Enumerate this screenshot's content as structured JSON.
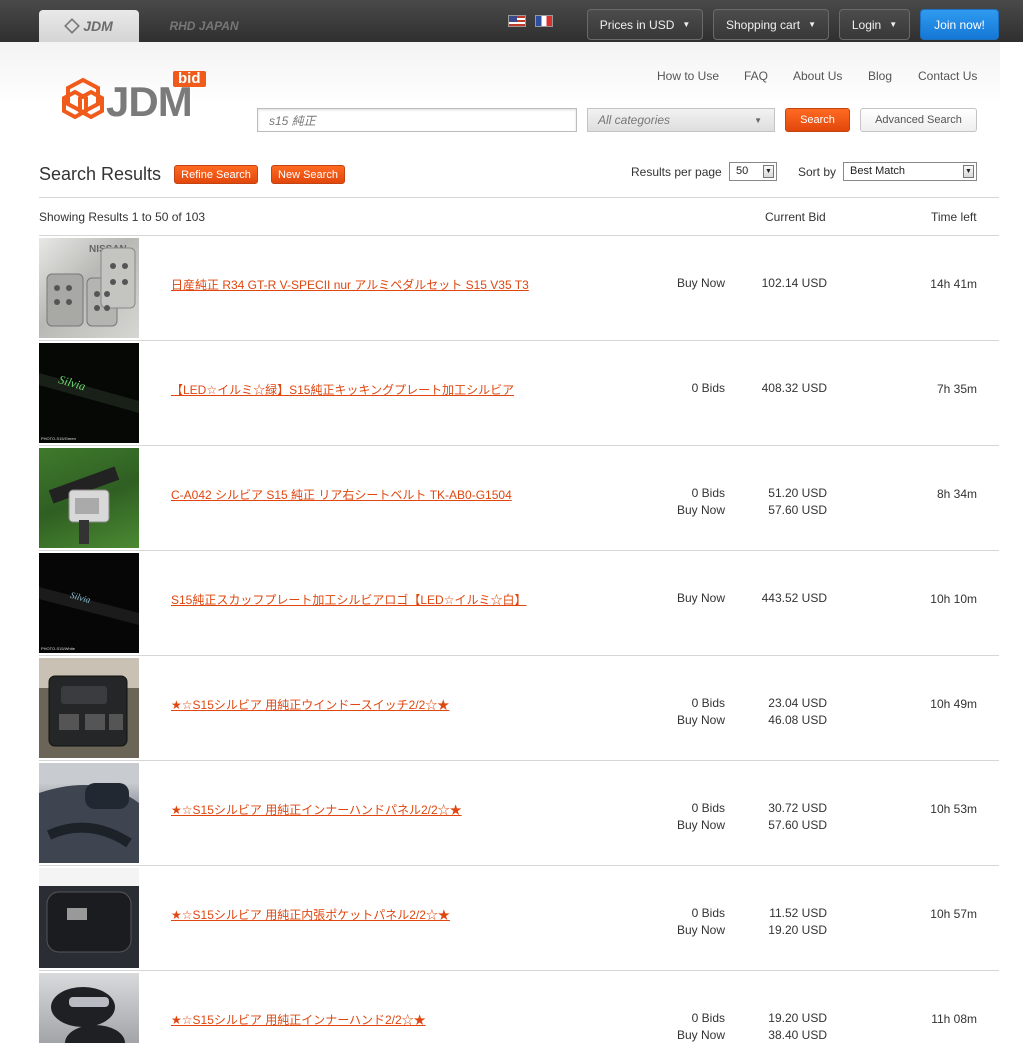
{
  "top_bar": {
    "site_tabs": [
      "JDM",
      "RHD JAPAN"
    ],
    "currency_label": "Prices in USD",
    "cart_label": "Shopping cart",
    "login_label": "Login",
    "join_label": "Join now!"
  },
  "logo": {
    "badge": "bid",
    "text": "JDM"
  },
  "nav": [
    "How to Use",
    "FAQ",
    "About Us",
    "Blog",
    "Contact Us"
  ],
  "search": {
    "query": "s15 純正",
    "category": "All categories",
    "search_label": "Search",
    "advanced_label": "Advanced Search"
  },
  "results": {
    "title": "Search Results",
    "refine_label": "Refine Search",
    "new_label": "New Search",
    "per_page_label": "Results per page",
    "per_page_value": "50",
    "sort_label": "Sort by",
    "sort_value": "Best Match",
    "showing": "Showing Results 1 to 50 of 103",
    "col_bid": "Current Bid",
    "col_time": "Time left"
  },
  "colors": {
    "accent": "#e2470b",
    "join": "#1a85e6",
    "topbar": "#3a3a3a"
  },
  "items": [
    {
      "title": "日産純正 R34 GT-R V-SPECII nur アルミペダルセット S15 V35 T3",
      "bids": "",
      "bid_price": "",
      "buy_label": "Buy Now",
      "buy_price": "102.14 USD",
      "time": "14h 41m",
      "thumb_caption": "",
      "thumb": "pedals"
    },
    {
      "title": "【LED☆イルミ☆緑】S15純正キッキングプレート加工シルビア",
      "bids": "0 Bids",
      "bid_price": "408.32 USD",
      "buy_label": "",
      "buy_price": "",
      "time": "7h 35m",
      "thumb_caption": "PHOTO-S15/Green",
      "thumb": "plate-green"
    },
    {
      "title": "C-A042 シルビア S15 純正 リア右シートベルト TK-AB0-G1504",
      "bids": "0 Bids",
      "bid_price": "51.20 USD",
      "buy_label": "Buy Now",
      "buy_price": "57.60 USD",
      "time": "8h 34m",
      "thumb_caption": "",
      "thumb": "belt"
    },
    {
      "title": "S15純正スカッフプレート加工シルビアロゴ【LED☆イルミ☆白】",
      "bids": "",
      "bid_price": "",
      "buy_label": "Buy Now",
      "buy_price": "443.52 USD",
      "time": "10h 10m",
      "thumb_caption": "PHOTO-S15/White",
      "thumb": "plate-white"
    },
    {
      "title": "★☆S15シルビア 用純正ウインドースイッチ2/2☆★",
      "bids": "0 Bids",
      "bid_price": "23.04 USD",
      "buy_label": "Buy Now",
      "buy_price": "46.08 USD",
      "time": "10h 49m",
      "thumb_caption": "",
      "thumb": "switch"
    },
    {
      "title": "★☆S15シルビア 用純正インナーハンドパネル2/2☆★",
      "bids": "0 Bids",
      "bid_price": "30.72 USD",
      "buy_label": "Buy Now",
      "buy_price": "57.60 USD",
      "time": "10h 53m",
      "thumb_caption": "",
      "thumb": "panel"
    },
    {
      "title": "★☆S15シルビア 用純正内張ポケットパネル2/2☆★",
      "bids": "0 Bids",
      "bid_price": "11.52 USD",
      "buy_label": "Buy Now",
      "buy_price": "19.20 USD",
      "time": "10h 57m",
      "thumb_caption": "",
      "thumb": "pocket"
    },
    {
      "title": "★☆S15シルビア 用純正インナーハンド2/2☆★",
      "bids": "0 Bids",
      "bid_price": "19.20 USD",
      "buy_label": "Buy Now",
      "buy_price": "38.40 USD",
      "time": "11h 08m",
      "thumb_caption": "",
      "thumb": "handle"
    }
  ]
}
